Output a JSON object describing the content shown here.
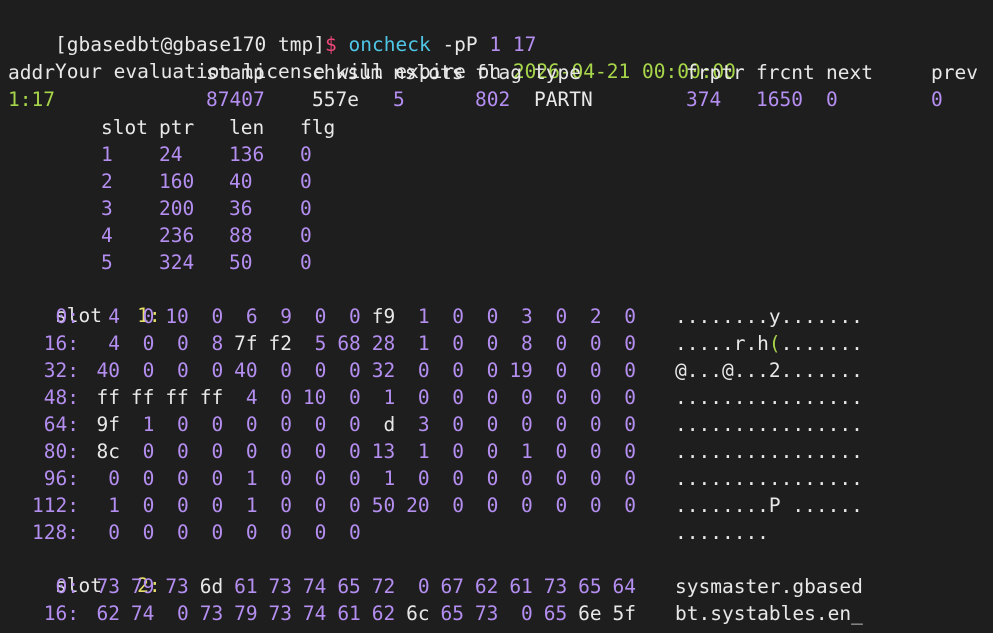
{
  "colors": {
    "background": "#1e1e1e",
    "text": "#e8e8e8",
    "number": "#b48ef0",
    "green": "#a8d64a",
    "yellow": "#e6df6a",
    "prompt_sigil": "#f0487a",
    "command": "#4fc6e6"
  },
  "prompt": {
    "user_host": "[gbasedbt@gbase170 tmp]",
    "sigil": "$",
    "command": "oncheck",
    "flag": "-pP",
    "arg1": "1",
    "arg2": "17"
  },
  "license": {
    "text": "Your evaluation license will expire on",
    "date": "2026-04-21 00:00:00"
  },
  "page_header": {
    "columns": [
      "addr",
      "stamp",
      "chksum",
      "nslots",
      "flag",
      "type",
      "frptr",
      "frcnt",
      "next",
      "prev"
    ],
    "values": [
      "1:17",
      "87407",
      "557e",
      "5",
      "802",
      "PARTN",
      "374",
      "1650",
      "0",
      "0"
    ]
  },
  "slot_table": {
    "columns": [
      "slot",
      "ptr",
      "len",
      "flg"
    ],
    "rows": [
      [
        "1",
        "24",
        "136",
        "0"
      ],
      [
        "2",
        "160",
        "40",
        "0"
      ],
      [
        "3",
        "200",
        "36",
        "0"
      ],
      [
        "4",
        "236",
        "88",
        "0"
      ],
      [
        "5",
        "324",
        "50",
        "0"
      ]
    ]
  },
  "slot1": {
    "label": "slot",
    "number": "1:",
    "rows": [
      {
        "offset": "0:",
        "bytes": [
          "4",
          "0",
          "10",
          "0",
          "6",
          "9",
          "0",
          "0",
          "f9",
          "1",
          "0",
          "0",
          "3",
          "0",
          "2",
          "0"
        ],
        "ascii": "........y......."
      },
      {
        "offset": "16:",
        "bytes": [
          "4",
          "0",
          "0",
          "8",
          "7f",
          "f2",
          "5",
          "68",
          "28",
          "1",
          "0",
          "0",
          "8",
          "0",
          "0",
          "0"
        ],
        "ascii_pre": ".....r.h",
        "ascii_hi": "(",
        "ascii_post": "......."
      },
      {
        "offset": "32:",
        "bytes": [
          "40",
          "0",
          "0",
          "0",
          "40",
          "0",
          "0",
          "0",
          "32",
          "0",
          "0",
          "0",
          "19",
          "0",
          "0",
          "0"
        ],
        "ascii": "@...@...2......."
      },
      {
        "offset": "48:",
        "bytes": [
          "ff",
          "ff",
          "ff",
          "ff",
          "4",
          "0",
          "10",
          "0",
          "1",
          "0",
          "0",
          "0",
          "0",
          "0",
          "0",
          "0"
        ],
        "ascii": "................"
      },
      {
        "offset": "64:",
        "bytes": [
          "9f",
          "1",
          "0",
          "0",
          "0",
          "0",
          "0",
          "0",
          "d",
          "3",
          "0",
          "0",
          "0",
          "0",
          "0",
          "0"
        ],
        "ascii": "................"
      },
      {
        "offset": "80:",
        "bytes": [
          "8c",
          "0",
          "0",
          "0",
          "0",
          "0",
          "0",
          "0",
          "13",
          "1",
          "0",
          "0",
          "1",
          "0",
          "0",
          "0"
        ],
        "ascii": "................"
      },
      {
        "offset": "96:",
        "bytes": [
          "0",
          "0",
          "0",
          "0",
          "1",
          "0",
          "0",
          "0",
          "1",
          "0",
          "0",
          "0",
          "0",
          "0",
          "0",
          "0"
        ],
        "ascii": "................"
      },
      {
        "offset": "112:",
        "bytes": [
          "1",
          "0",
          "0",
          "0",
          "1",
          "0",
          "0",
          "0",
          "50",
          "20",
          "0",
          "0",
          "0",
          "0",
          "0",
          "0"
        ],
        "ascii": "........P ......"
      },
      {
        "offset": "128:",
        "bytes": [
          "0",
          "0",
          "0",
          "0",
          "0",
          "0",
          "0",
          "0"
        ],
        "ascii": "........"
      }
    ]
  },
  "slot2": {
    "label": "slot",
    "number": "2:",
    "rows": [
      {
        "offset": "0:",
        "bytes": [
          "73",
          "79",
          "73",
          "6d",
          "61",
          "73",
          "74",
          "65",
          "72",
          "0",
          "67",
          "62",
          "61",
          "73",
          "65",
          "64"
        ],
        "ascii": "sysmaster.gbased"
      },
      {
        "offset": "16:",
        "bytes": [
          "62",
          "74",
          "0",
          "73",
          "79",
          "73",
          "74",
          "61",
          "62",
          "6c",
          "65",
          "73",
          "0",
          "65",
          "6e",
          "5f"
        ],
        "ascii": "bt.systables.en_"
      }
    ]
  }
}
